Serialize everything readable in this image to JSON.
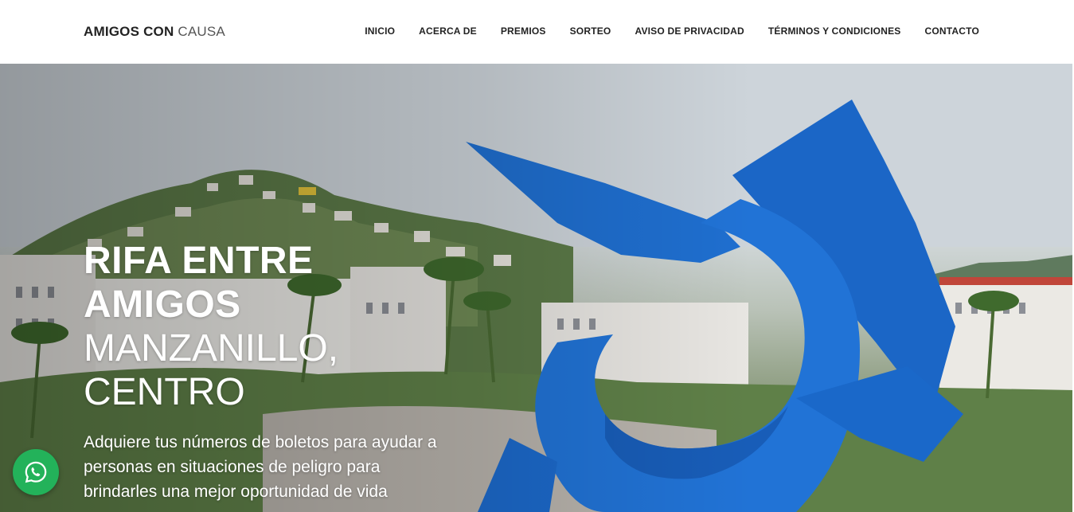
{
  "header": {
    "brand_bold": "AMIGOS CON",
    "brand_light": "CAUSA",
    "nav": [
      {
        "label": "INICIO"
      },
      {
        "label": "ACERCA DE"
      },
      {
        "label": "PREMIOS"
      },
      {
        "label": "SORTEO"
      },
      {
        "label": "AVISO DE PRIVACIDAD"
      },
      {
        "label": "TÉRMINOS Y CONDICIONES"
      },
      {
        "label": "CONTACTO"
      }
    ]
  },
  "hero": {
    "title_line1": "RIFA ENTRE",
    "title_line2": "AMIGOS",
    "title_line3": "MANZANILLO,",
    "title_line4": "CENTRO",
    "subtitle": "Adquiere tus números de boletos para ayudar a personas en situaciones de peligro para brindarles una mejor oportunidad de vida",
    "image_icon": "sailfish-sculpture-photo"
  },
  "floating": {
    "whatsapp_icon": "whatsapp-icon",
    "whatsapp_color": "#23b25a"
  },
  "colors": {
    "sculpture_blue": "#1f6fd0",
    "text_dark": "#222222"
  }
}
